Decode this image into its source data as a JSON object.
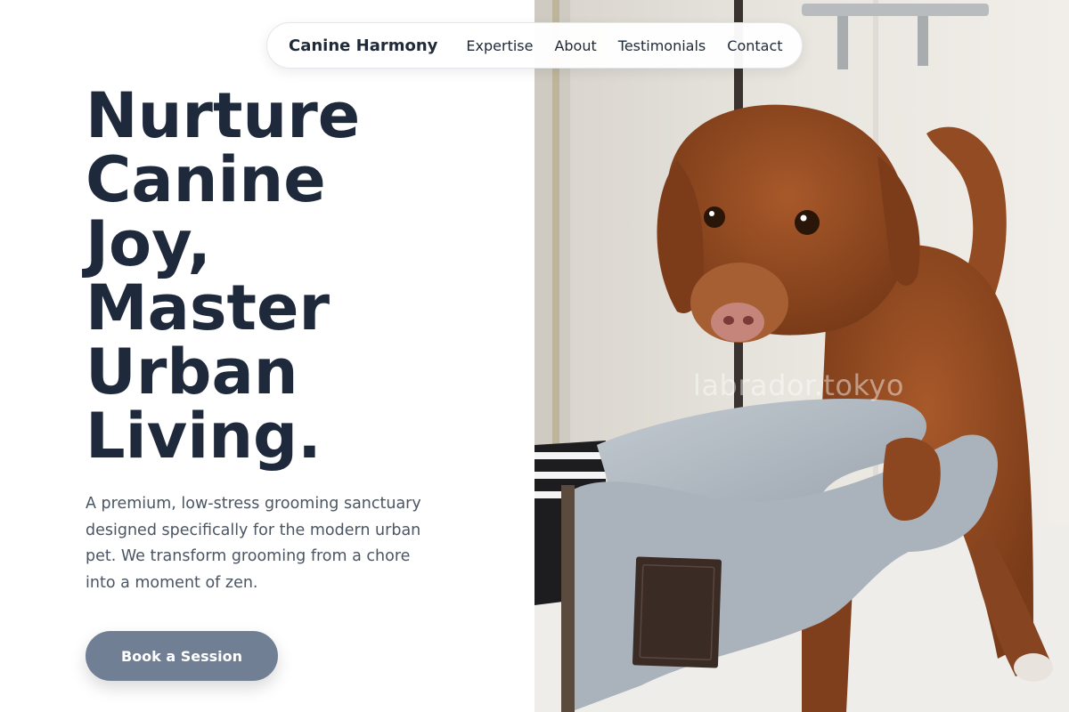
{
  "nav": {
    "brand": "Canine Harmony",
    "links": [
      "Expertise",
      "About",
      "Testimonials",
      "Contact"
    ]
  },
  "hero": {
    "headline_lines": [
      "Nurture",
      "Canine",
      "Joy,",
      "Master",
      "Urban",
      "Living."
    ],
    "lead": "A premium, low-stress grooming sanctuary designed specifically for the modern urban pet. We transform grooming from a chore into a moment of zen.",
    "cta_label": "Book a Session",
    "image_watermark": "labrador.tokyo"
  },
  "colors": {
    "heading": "#1e293b",
    "body_text": "#4b5563",
    "cta_bg": "#717f94",
    "dog_fur": "#8f4a22",
    "towel": "#b4bcc4"
  }
}
